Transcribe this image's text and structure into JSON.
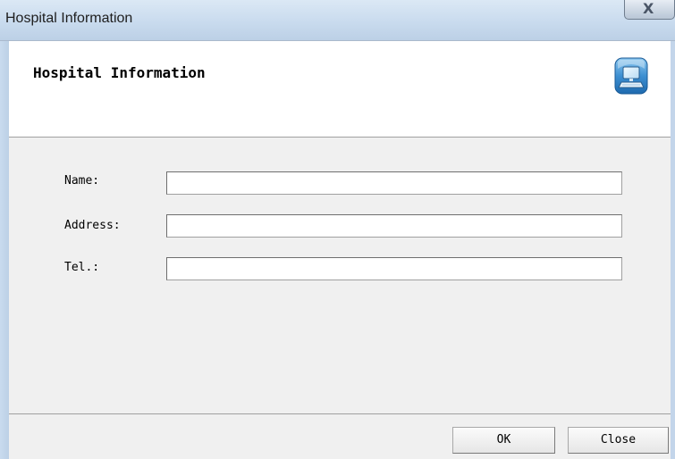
{
  "window": {
    "title": "Hospital Information",
    "close_glyph": "X"
  },
  "header": {
    "title": "Hospital Information",
    "icon": "computer-icon"
  },
  "form": {
    "name": {
      "label": "Name:",
      "value": ""
    },
    "address": {
      "label": "Address:",
      "value": ""
    },
    "tel": {
      "label": "Tel.:",
      "value": ""
    }
  },
  "buttons": {
    "ok_label": "OK",
    "close_label": "Close"
  },
  "colors": {
    "titlebar": "#c9dbee",
    "dialog_bg": "#f0f0f0",
    "header_bg": "#ffffff"
  }
}
